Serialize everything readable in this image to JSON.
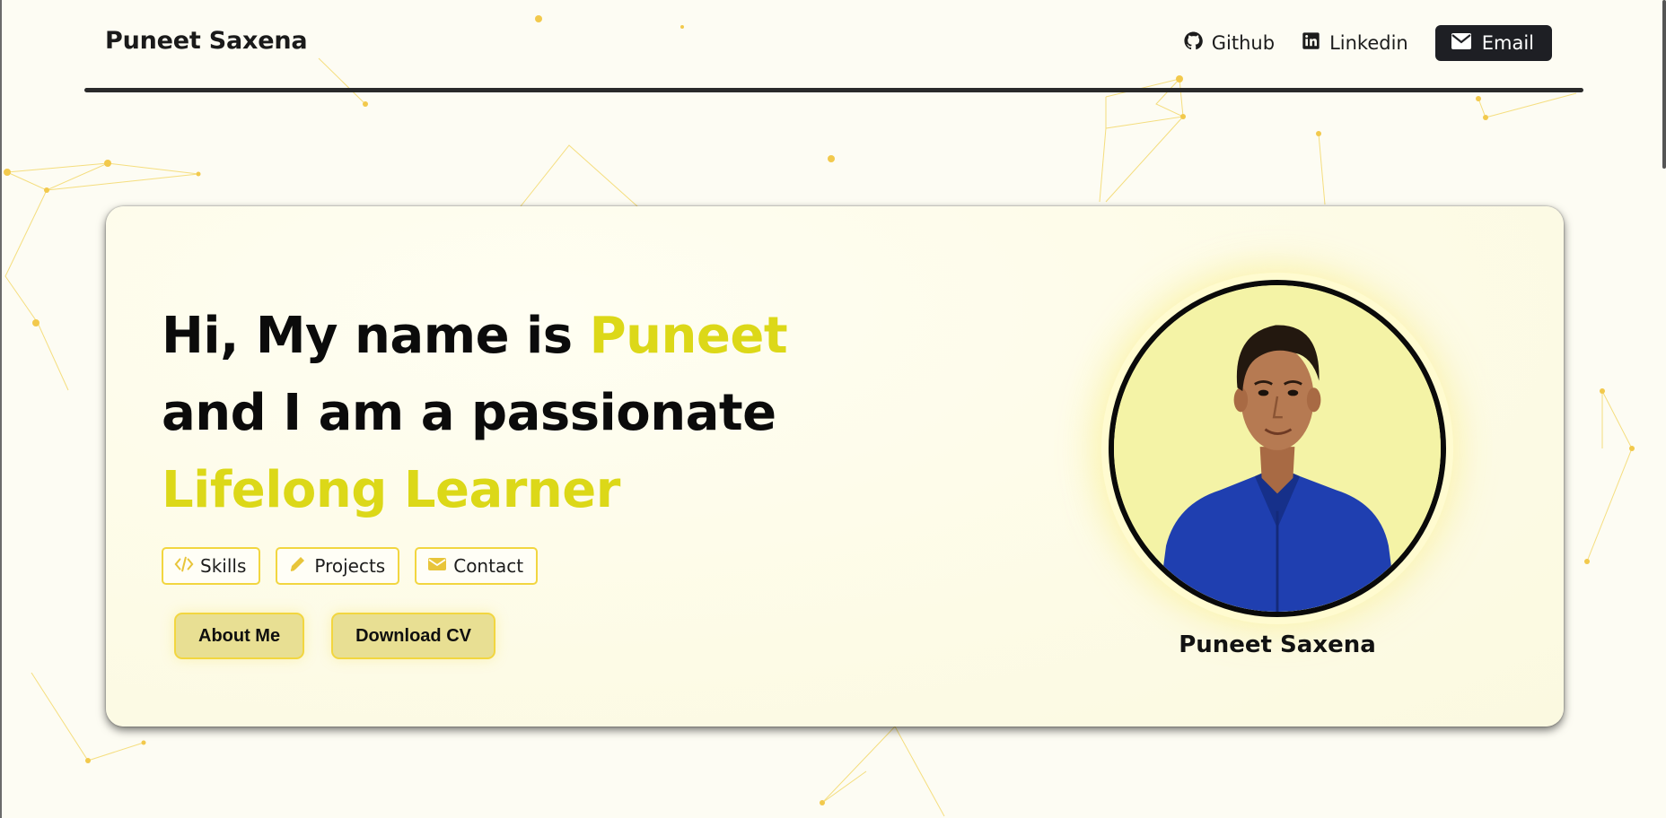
{
  "header": {
    "brand": "Puneet Saxena",
    "nav": [
      {
        "label": "Github",
        "icon": "github-icon"
      },
      {
        "label": "Linkedin",
        "icon": "linkedin-icon"
      }
    ],
    "email_label": "Email"
  },
  "hero": {
    "line1_prefix": "Hi, My name is ",
    "line1_name": "Puneet",
    "line2": "and I am a passionate",
    "line3": "Lifelong Learner",
    "chips": [
      {
        "label": "Skills",
        "icon": "code-icon"
      },
      {
        "label": "Projects",
        "icon": "pencil-icon"
      },
      {
        "label": "Contact",
        "icon": "envelope-icon"
      }
    ],
    "buttons": {
      "about": "About Me",
      "download": "Download CV"
    },
    "avatar_caption": "Puneet Saxena"
  },
  "colors": {
    "background": "#fdfcf3",
    "accent_yellow": "#dcd818",
    "chip_border": "#f2d640",
    "button_fill": "#e8df93",
    "dark": "#1e1f24"
  }
}
